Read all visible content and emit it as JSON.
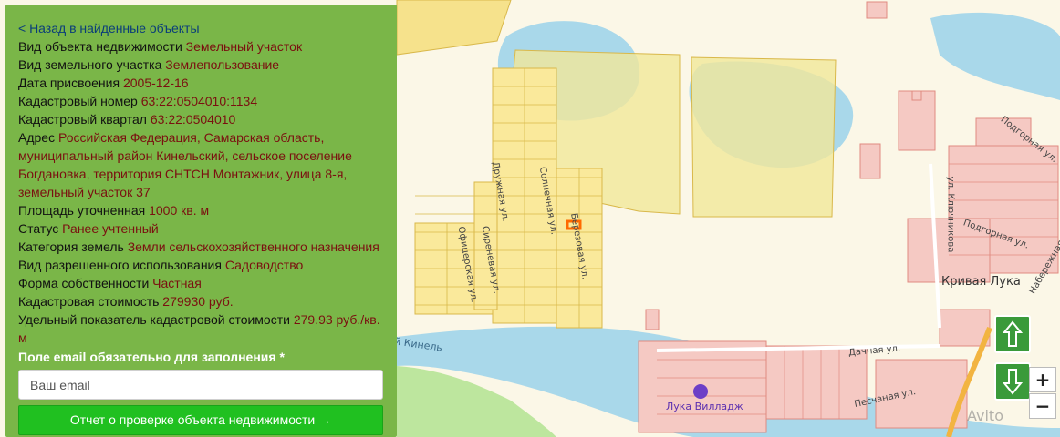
{
  "panel": {
    "back_link": "< Назад в найденные объекты",
    "fields": [
      {
        "label": "Вид объекта недвижимости",
        "value": "Земельный участок"
      },
      {
        "label": "Вид земельного участка",
        "value": "Землепользование"
      },
      {
        "label": "Дата присвоения",
        "value": "2005-12-16"
      },
      {
        "label": "Кадастровый номер",
        "value": "63:22:0504010:1134"
      },
      {
        "label": "Кадастровый квартал",
        "value": "63:22:0504010"
      },
      {
        "label": "Адрес",
        "value": "Российская Федерация, Самарская область, муниципальный район Кинельский, сельское поселение Богдановка, территория СНТСН Монтажник, улица 8-я, земельный участок 37"
      },
      {
        "label": "Площадь уточненная",
        "value": "1000 кв. м"
      },
      {
        "label": "Статус",
        "value": "Ранее учтенный"
      },
      {
        "label": "Категория земель",
        "value": "Земли сельскохозяйственного назначения"
      },
      {
        "label": "Вид разрешенного использования",
        "value": "Садоводство"
      },
      {
        "label": "Форма собственности",
        "value": "Частная"
      },
      {
        "label": "Кадастровая стоимость",
        "value": "279930 руб."
      },
      {
        "label": "Удельный показатель кадастровой стоимости",
        "value": "279.93 руб./кв. м"
      }
    ],
    "email_label": "Поле email обязательно для заполнения *",
    "email_placeholder": "Ваш email",
    "report_button": "Отчет о проверке объекта недвижимости →"
  },
  "map": {
    "labels": {
      "town": "Кривая Лука",
      "poi": "Лука Вилладж",
      "river": "й Кинель",
      "street_podgornaya_1": "Подгорная ул.",
      "street_podgornaya_2": "Подгорная ул.",
      "street_klyuchnikova": "ул. Ключникова",
      "street_naberezhnaya": "Набережная ул.",
      "street_dachnaya": "Дачная ул.",
      "street_peschanaya": "Песчаная ул.",
      "street_druzhnaya": "Дружная ул.",
      "street_solnechnaya": "Солнечная ул.",
      "street_sirenevaya": "Сиреневая ул.",
      "street_ofitserskaya": "Офицерская ул.",
      "street_berezovaya": "Березовая ул."
    },
    "controls": {
      "pan_up_icon": "arrow-up-icon",
      "pan_down_icon": "arrow-down-icon",
      "zoom_in": "+",
      "zoom_out": "−"
    },
    "watermark": "Avito",
    "colors": {
      "parcel_fill": "#fae99b",
      "parcel_stroke": "#d9b84a",
      "building": "#f5c9c3",
      "water": "#a9d8ea",
      "highlight": "#ff6a00",
      "panel": "#7ab648"
    }
  }
}
